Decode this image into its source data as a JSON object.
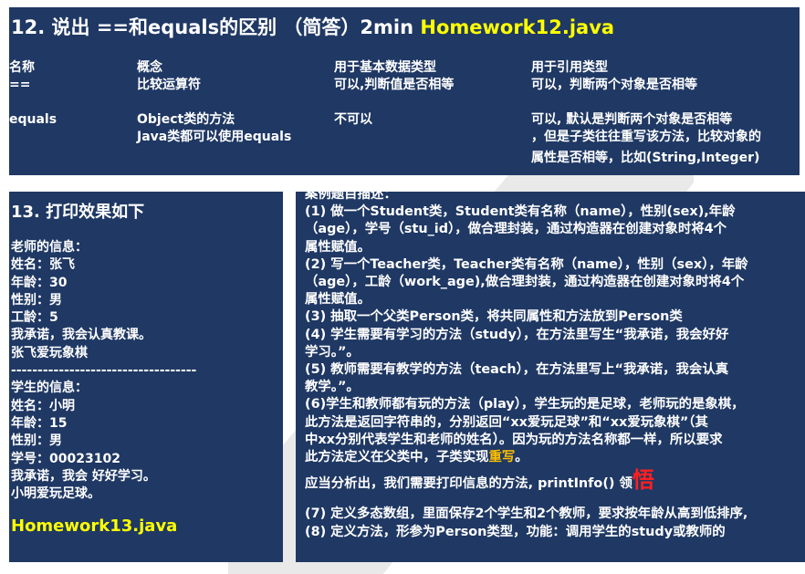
{
  "slide12": {
    "title": "12. 说出 ==和equals的区别 （简答）2min",
    "file": "Homework12.java",
    "headers": [
      "名称",
      "概念",
      "用于基本数据类型",
      "用于引用类型"
    ],
    "row1": [
      "==",
      "比较运算符",
      "可以,判断值是否相等",
      "可以，判断两个对象是否相等"
    ],
    "row2": {
      "name": "equals",
      "concept_l1": "Object类的方法",
      "concept_l2": "Java类都可以使用equals",
      "basic": "不可以",
      "ref_l1": "可以, 默认是判断两个对象是否相等",
      "ref_l2": "，但是子类往往重写该方法，比较对象的",
      "ref_l3": "属性是否相等，比如(String,Integer)"
    }
  },
  "slide13": {
    "title": "13. 打印效果如下",
    "lines": [
      "老师的信息：",
      "姓名：张飞",
      "年龄：30",
      "性别：男",
      "工龄：5",
      "我承诺，我会认真教课。",
      "张飞爱玩象棋",
      "-----------------------------------",
      "学生的信息：",
      "姓名：小明",
      "年龄：15",
      "性别：男",
      "学号：00023102",
      "我承诺，我会 好好学习。",
      "小明爱玩足球。"
    ],
    "file": "Homework13.java"
  },
  "requirements": {
    "heading": "案例题目描述：",
    "l1": "(1) 做一个Student类，Student类有名称（name），性别(sex),年龄",
    "l2": "（age），学号（stu_id），做合理封装，通过构造器在创建对象时将4个",
    "l3": "属性赋值。",
    "l4": "(2) 写一个Teacher类，Teacher类有名称（name），性别（sex），年龄",
    "l5": "（age），工龄（work_age),做合理封装，通过构造器在创建对象时将4个",
    "l6": "属性赋值。",
    "l7": "(3) 抽取一个父类Person类，将共同属性和方法放到Person类",
    "l8": "(4) 学生需要有学习的方法（study），在方法里写生“我承诺，我会好好",
    "l9": "学习。”。",
    "l10": "(5) 教师需要有教学的方法（teach），在方法里写上“我承诺，我会认真",
    "l11": "教学。”。",
    "l12": "(6)学生和教师都有玩的方法（play），学生玩的是足球，老师玩的是象棋，",
    "l13": "此方法是返回字符串的，分别返回“xx爱玩足球”和“xx爱玩象棋”（其",
    "l14": "中xx分别代表学生和老师的姓名）。因为玩的方法名称都一样，所以要求",
    "l15a": "此方法定义在父类中，子类实现",
    "l15b": "重写",
    "l15c": "。",
    "l16a": "应当分析出，我们需要打印信息的方法, printInfo() 领",
    "l16b": "悟",
    "l17": "(7) 定义多态数组，里面保存2个学生和2个教师，要求按年龄从高到低排序,",
    "l18": "(8) 定义方法，形参为Person类型，功能：调用学生的study或教师的"
  },
  "colors": {
    "panel": "#1f3864",
    "accent_yellow": "#ffff00",
    "accent_orange": "#ffc000",
    "accent_red": "#ff2020"
  }
}
